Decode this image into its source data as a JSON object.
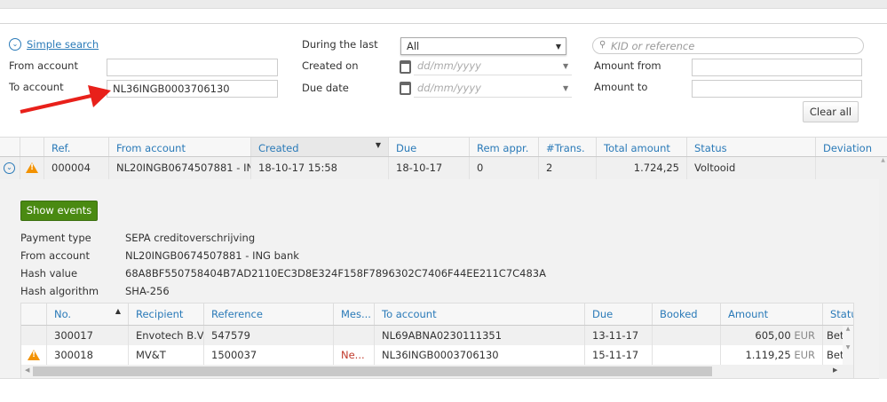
{
  "search": {
    "toggle_label": "Simple search",
    "from_account_label": "From account",
    "from_account_value": "",
    "to_account_label": "To account",
    "to_account_value": "NL36INGB0003706130",
    "during_label": "During the last",
    "during_value": "All",
    "created_label": "Created on",
    "created_placeholder": "dd/mm/yyyy",
    "due_label": "Due date",
    "due_placeholder": "dd/mm/yyyy",
    "kid_placeholder": "KID or reference",
    "amount_from_label": "Amount from",
    "amount_to_label": "Amount to",
    "clear_label": "Clear all"
  },
  "table": {
    "headers": [
      "Ref.",
      "From account",
      "Created",
      "Due",
      "Rem appr.",
      "#Trans.",
      "Total amount",
      "Status",
      "Deviation"
    ],
    "rows": [
      {
        "ref": "000004",
        "from": "NL20INGB0674507881 - IN...",
        "created": "18-10-17 15:58",
        "due": "18-10-17",
        "rem": "0",
        "trans": "2",
        "total": "1.724,25",
        "status": "Voltooid",
        "deviation": ""
      }
    ]
  },
  "details": {
    "show_events_label": "Show events",
    "fields": [
      {
        "label": "Payment type",
        "value": "SEPA creditoverschrijving"
      },
      {
        "label": "From account",
        "value": "NL20INGB0674507881 - ING bank"
      },
      {
        "label": "Hash value",
        "value": "68A8BF550758404B7AD2110EC3D8E324F158F7896302C7406F44EE211C7C483A"
      },
      {
        "label": "Hash algorithm",
        "value": "SHA-256"
      }
    ]
  },
  "subtable": {
    "headers": [
      "No.",
      "Recipient",
      "Reference",
      "Mes...",
      "To account",
      "Due",
      "Booked",
      "Amount",
      "Status"
    ],
    "rows": [
      {
        "no": "300017",
        "recipient": "Envotech B.V.",
        "reference": "547579",
        "message": "",
        "to": "NL69ABNA0230111351",
        "due": "13-11-17",
        "booked": "",
        "amount": "605,00",
        "currency": "EUR",
        "status": "Bet"
      },
      {
        "no": "300018",
        "recipient": "MV&T",
        "reference": "1500037",
        "message": "Ne...",
        "to": "NL36INGB0003706130",
        "due": "15-11-17",
        "booked": "",
        "amount": "1.119,25",
        "currency": "EUR",
        "status": "Bet"
      }
    ]
  },
  "colors": {
    "accent": "#2a7ab8",
    "button_green": "#4a8a12",
    "warning": "#f39200",
    "arrow": "#e8201a"
  }
}
